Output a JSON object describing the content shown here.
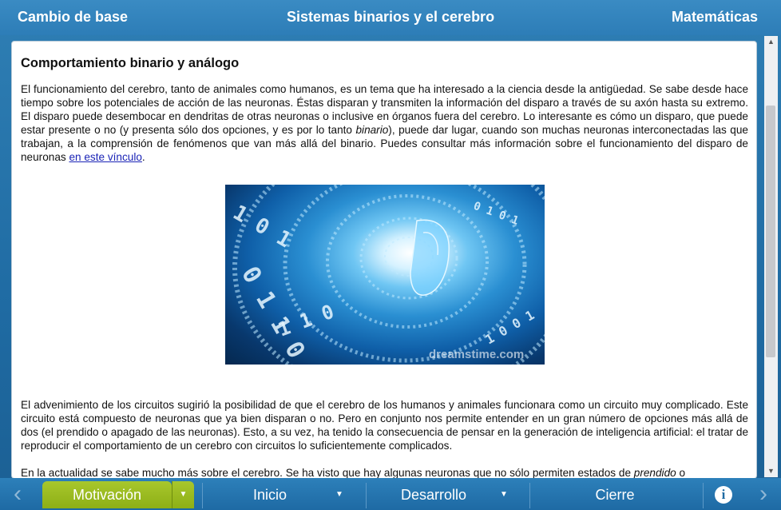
{
  "header": {
    "left": "Cambio de base",
    "center": "Sistemas binarios y el cerebro",
    "right": "Matemáticas"
  },
  "content": {
    "heading": "Comportamiento binario y análogo",
    "p1_a": "El funcionamiento del cerebro, tanto de animales como humanos, es un tema que ha interesado a la ciencia desde la antigüedad. Se sabe desde hace tiempo sobre los potenciales de acción de las neuronas. Éstas disparan y transmiten la información del disparo a través de su axón hasta su extremo. El disparo puede desembocar en dendritas de otras neuronas o inclusive en órganos fuera del cerebro. Lo interesante es cómo un disparo, que puede estar presente o no (y presenta sólo dos opciones, y es por lo tanto ",
    "p1_em": "binario",
    "p1_b": "), puede dar lugar, cuando son muchas neuronas interconectadas las que trabajan, a la comprensión de fenómenos que van más allá del binario. Puedes consultar más información sobre el funcionamiento del disparo de neuronas ",
    "p1_link": "en este vínculo",
    "p1_end": ".",
    "image_watermark": "dreamstime.com",
    "p2": "El advenimiento de los circuitos sugirió la posibilidad de que el cerebro de los humanos y animales funcionara como un circuito muy complicado. Este circuito está compuesto de neuronas que ya bien disparan o no. Pero en conjunto nos permite entender en un gran número de opciones más allá de dos (el prendido o apagado de las neuronas). Esto, a su vez, ha tenido la consecuencia de pensar en la generación de inteligencia artificial: el tratar de reproducir el comportamiento de un cerebro con circuitos lo suficientemente complicados.",
    "p3_a": "En la actualidad se sabe mucho más sobre el cerebro. Se ha visto que hay algunas neuronas que no sólo permiten estados de ",
    "p3_em": "prendido",
    "p3_b": " o"
  },
  "nav": {
    "prev_icon": "chevron-left-icon",
    "next_icon": "chevron-right-icon",
    "info_icon": "info-icon",
    "tabs": [
      "Motivación",
      "Inicio",
      "Desarrollo",
      "Cierre"
    ],
    "info_label": "i",
    "active_tab": "Motivación"
  },
  "colors": {
    "header_bg": "#2d7db7",
    "active_tab": "#9bbd1f",
    "link": "#1a23b6"
  }
}
